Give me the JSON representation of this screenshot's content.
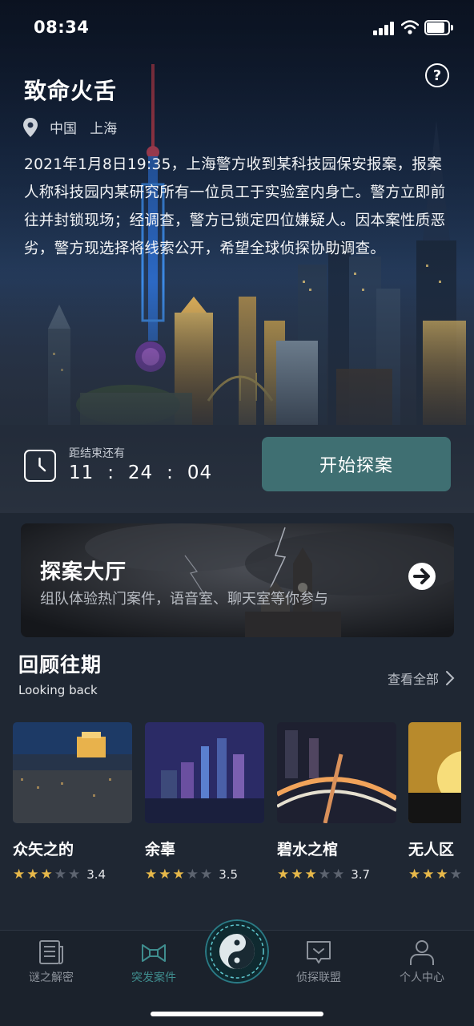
{
  "status_bar": {
    "time": "08:34"
  },
  "case": {
    "title": "致命火舌",
    "location": "中国   上海",
    "description": "2021年1月8日19:35，上海警方收到某科技园保安报案，报案人称科技园内某研究所有一位员工于实验室内身亡。警方立即前往并封锁现场；经调查，警方已锁定四位嫌疑人。因本案性质恶劣，警方现选择将线索公开，希望全球侦探协助调查。"
  },
  "timer": {
    "label": "距结束还有",
    "hours": "11",
    "minutes": "24",
    "seconds": "04",
    "separator": ":"
  },
  "start_button": "开始探案",
  "hall": {
    "title": "探案大厅",
    "subtitle": "组队体验热门案件，语音室、聊天室等你参与"
  },
  "review": {
    "title": "回顾往期",
    "subtitle": "Looking back",
    "view_all": "查看全部",
    "items": [
      {
        "name": "众矢之的",
        "rating": 3,
        "score": "3.4"
      },
      {
        "name": "余辜",
        "rating": 3,
        "score": "3.5"
      },
      {
        "name": "碧水之棺",
        "rating": 3,
        "score": "3.7"
      },
      {
        "name": "无人区",
        "rating": 3,
        "score": ""
      }
    ]
  },
  "tabs": [
    {
      "label": "谜之解密",
      "icon": "newspaper-icon"
    },
    {
      "label": "突发案件",
      "icon": "ribbon-icon"
    },
    {
      "label": "",
      "icon": "taiji-icon"
    },
    {
      "label": "侦探联盟",
      "icon": "chat-icon"
    },
    {
      "label": "个人中心",
      "icon": "person-icon"
    }
  ],
  "colors": {
    "accent": "#3f6f72",
    "active_tab": "#3f8d8e",
    "star": "#e7b84a",
    "background": "#1f2733"
  }
}
